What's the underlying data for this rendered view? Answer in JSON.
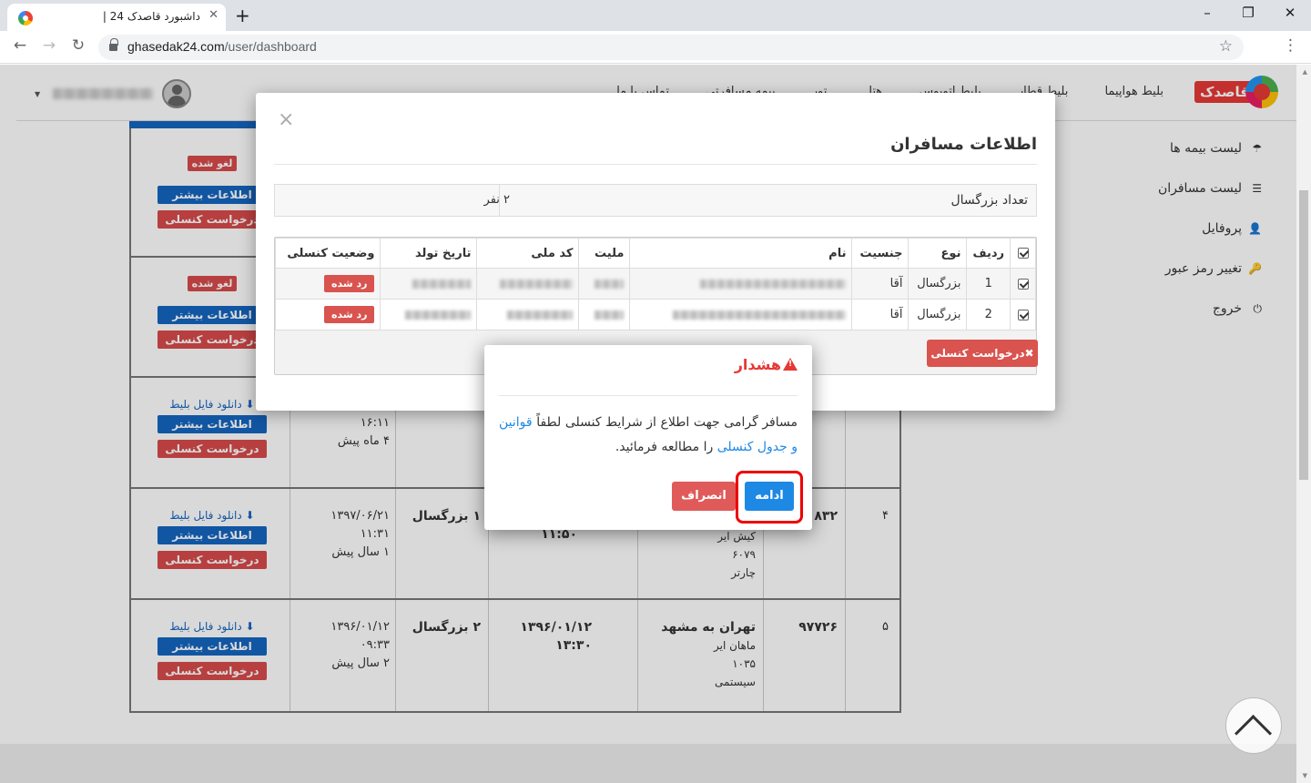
{
  "browser": {
    "tab_title": "داشبورد قاصدک 24 |",
    "tab_close": "✕",
    "new_tab": "+",
    "url_host": "ghasedak24.com",
    "url_path": "/user/dashboard",
    "window_minimize": "–",
    "window_restore": "❐",
    "window_close": "✕"
  },
  "header": {
    "logo_text": "قاصدک",
    "nav": [
      "بلیط هواپیما",
      "بلیط قطار",
      "بلیط اتوبوس",
      "هتل",
      "تور",
      "بیمه مسافرتی",
      "تماس با ما"
    ]
  },
  "sidebar": {
    "items": [
      {
        "icon": "umbrella-icon",
        "glyph": "☂",
        "label": "لیست بیمه ها"
      },
      {
        "icon": "list-icon",
        "glyph": "☰",
        "label": "لیست مسافران"
      },
      {
        "icon": "user-icon",
        "glyph": "👤",
        "label": "پروفایل"
      },
      {
        "icon": "key-icon",
        "glyph": "🔑",
        "label": "تغییر رمز عبور"
      },
      {
        "icon": "power-icon",
        "glyph": "⏻",
        "label": "خروج"
      }
    ]
  },
  "reservations": {
    "canceled_label": "لغو شده",
    "more_info": "اطلاعات بیشتر",
    "cancel_request": "درخواست کنسلی",
    "download_ticket": "دانلود فایل بلیط",
    "rows": [
      {
        "time": "",
        "ago": ""
      },
      {
        "time": "",
        "ago": ""
      },
      {
        "time": "۱۶:۱۱",
        "ago": "۴ ماه پیش"
      },
      {
        "index": "۴",
        "code": "۸۳۲",
        "route_lines": [
          "کیش ایر",
          "۶۰۷۹",
          "چارتر"
        ],
        "flight_time": "۱۱:۵۰",
        "passengers": "۱ بزرگسال",
        "date": "۱۳۹۷/۰۶/۲۱",
        "time": "۱۱:۳۱",
        "ago": "۱ سال پیش"
      },
      {
        "index": "۵",
        "code": "۹۷۷۲۶",
        "route": "تهران به مشهد",
        "route_lines": [
          "ماهان ایر",
          "۱۰۳۵",
          "سیستمی"
        ],
        "flight_date": "۱۳۹۶/۰۱/۱۲",
        "flight_time": "۱۳:۳۰",
        "passengers": "۲ بزرگسال",
        "date": "۱۳۹۶/۰۱/۱۲",
        "time": "۰۹:۳۳",
        "ago": "۲ سال پیش"
      }
    ]
  },
  "passenger_modal": {
    "close": "×",
    "title": "اطلاعات مسافران",
    "adult_count_label": "تعداد بزرگسال",
    "adult_count_value": "۲ نفر",
    "columns": [
      "ردیف",
      "نوع",
      "جنسیت",
      "نام",
      "ملیت",
      "کد ملی",
      "تاریخ تولد",
      "وضعیت کنسلی"
    ],
    "rows": [
      {
        "index": "1",
        "type": "بزرگسال",
        "gender": "آقا",
        "status": "رد شده"
      },
      {
        "index": "2",
        "type": "بزرگسال",
        "gender": "آقا",
        "status": "رد شده"
      }
    ],
    "cancel_request_button": "✖درخواست کنسلی"
  },
  "warning_dialog": {
    "title": "هشدار",
    "body_before": "مسافر گرامی جهت اطلاع از شرایط کنسلی لطفاً",
    "link_text": "قوانین و جدول کنسلی",
    "body_after": "را مطالعه فرمائید.",
    "continue_button": "ادامه",
    "cancel_button": "انصراف"
  },
  "colors": {
    "primary": "#1565c0",
    "danger": "#d9534f",
    "warning_title": "#e53935",
    "highlight": "#ee0000"
  }
}
